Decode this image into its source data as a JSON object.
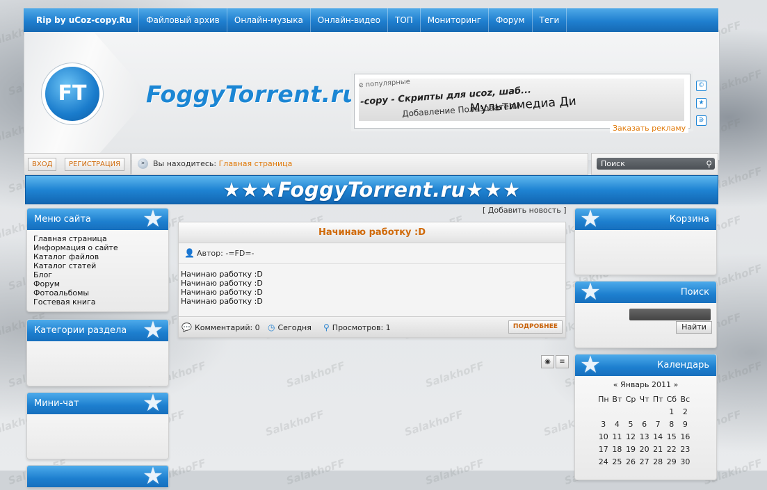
{
  "nav": {
    "items": [
      "Rip by uCoz-copy.Ru",
      "Файловый архив",
      "Онлайн-музыка",
      "Онлайн-видео",
      "ТОП",
      "Мониторинг",
      "Форум",
      "Теги"
    ]
  },
  "header": {
    "logo_mark": "FT",
    "logo_text": "FoggyTorrent.ru",
    "ad_link": "Заказать рекламу",
    "ad_image": {
      "l1": "ее популярные",
      "l2": "-copy - Скрипты для ucoz, шаб...",
      "l3": "Добавление   Пользователи",
      "l4": "Мультимедиа   Ди"
    },
    "side_icons": [
      "©",
      "★",
      "rss"
    ]
  },
  "loginbar": {
    "login": "ВХОД",
    "register": "РЕГИСТРАЦИЯ",
    "breadcrumb_prefix": "Вы находитесь:",
    "breadcrumb_link": "Главная страница",
    "search_placeholder": "Поиск"
  },
  "banner": {
    "text": "★★★FoggyTorrent.ru★★★"
  },
  "watermark": "SalakhoFF",
  "left": {
    "menu_title": "Меню сайта",
    "menu_items": [
      "Главная страница",
      "Информация о сайте",
      "Каталог файлов",
      "Каталог статей",
      "Блог",
      "Форум",
      "Фотоальбомы",
      "Гостевая книга"
    ],
    "categories_title": "Категории раздела",
    "minichat_title": "Мини-чат"
  },
  "center": {
    "add_news": "[ Добавить новость ]",
    "post": {
      "title": "Начинаю работку :D",
      "author": "Автор: -=FD=-",
      "body": [
        "Начинаю работку :D",
        "Начинаю работку :D",
        "Начинаю работку :D",
        "Начинаю работку :D"
      ],
      "comments": "Комментарий: 0",
      "date": "Сегодня",
      "views": "Просмотров: 1",
      "more": "ПОДРОБНЕЕ"
    }
  },
  "right": {
    "cart_title": "Корзина",
    "search_title": "Поиск",
    "search_button": "Найти",
    "calendar_title": "Календарь",
    "calendar_month": "«  Январь 2011  »",
    "calendar_days": [
      "Пн",
      "Вт",
      "Ср",
      "Чт",
      "Пт",
      "Сб",
      "Вс"
    ],
    "calendar_weeks": [
      [
        "",
        "",
        "",
        "",
        "",
        "1",
        "2"
      ],
      [
        "3",
        "4",
        "5",
        "6",
        "7",
        "8",
        "9"
      ],
      [
        "10",
        "11",
        "12",
        "13",
        "14",
        "15",
        "16"
      ],
      [
        "17",
        "18",
        "19",
        "20",
        "21",
        "22",
        "23"
      ],
      [
        "24",
        "25",
        "26",
        "27",
        "28",
        "29",
        "30"
      ]
    ]
  }
}
